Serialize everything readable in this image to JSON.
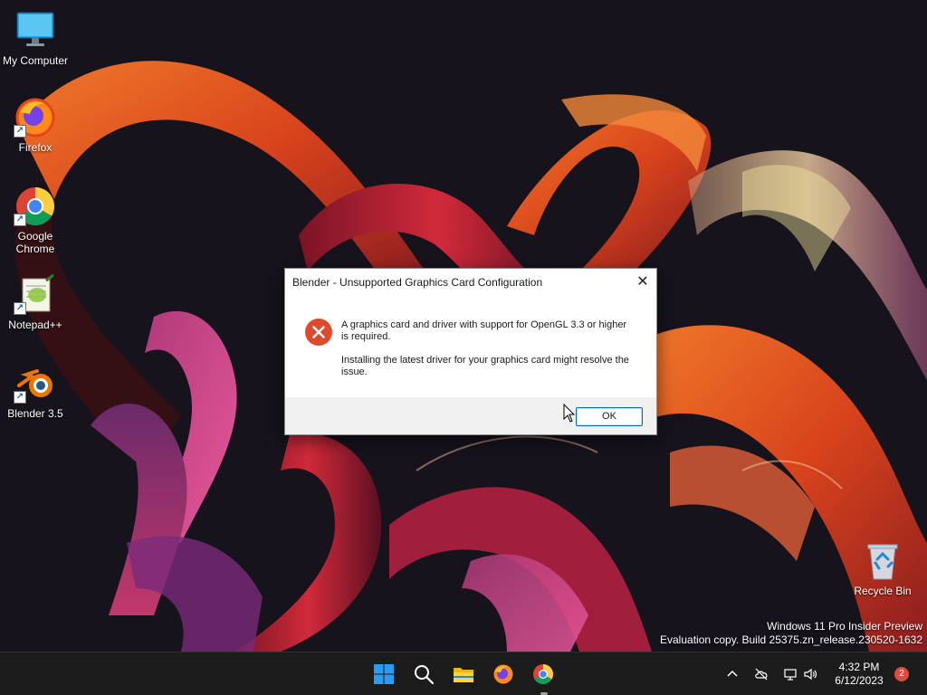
{
  "desktop": {
    "icons": [
      {
        "label": "My Computer",
        "icon": "monitor-icon"
      },
      {
        "label": "Firefox",
        "icon": "firefox-icon",
        "shortcut": true
      },
      {
        "label": "Google Chrome",
        "icon": "chrome-icon",
        "shortcut": true
      },
      {
        "label": "Notepad++",
        "icon": "notepadpp-icon",
        "shortcut": true
      },
      {
        "label": "Blender 3.5",
        "icon": "blender-icon",
        "shortcut": true
      },
      {
        "label": "Recycle Bin",
        "icon": "recycle-bin-icon"
      }
    ],
    "watermark": {
      "line1": "Windows 11 Pro Insider Preview",
      "line2": "Evaluation copy. Build 25375.zn_release.230520-1632"
    }
  },
  "dialog": {
    "title": "Blender - Unsupported Graphics Card Configuration",
    "close_glyph": "✕",
    "icon": "error-icon",
    "message_line1": "A graphics card and driver with support for OpenGL 3.3 or higher is required.",
    "message_line2": "Installing the latest driver for your graphics card might resolve the issue.",
    "ok_label": "OK"
  },
  "taskbar": {
    "items": [
      "start-icon",
      "search-icon",
      "file-explorer-icon",
      "firefox-icon",
      "chrome-icon"
    ],
    "tray": [
      "chevron-up-icon",
      "cloud-offline-icon",
      "network-icon",
      "volume-icon"
    ],
    "time": "4:32 PM",
    "date": "6/12/2023",
    "notification_count": "2"
  },
  "colors": {
    "accent": "#0067c0",
    "error": "#e04a2c",
    "taskbar": "#1c1c1c"
  }
}
